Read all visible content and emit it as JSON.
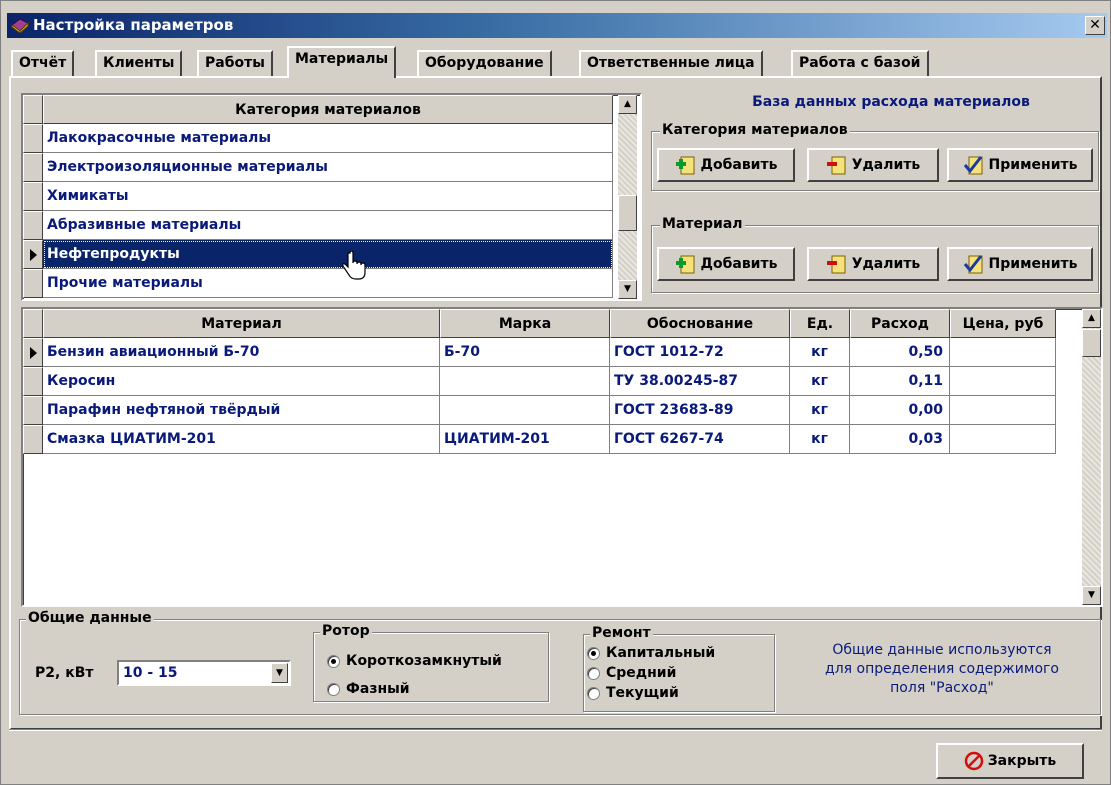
{
  "window": {
    "title": "Настройка параметров",
    "close_glyph": "✕"
  },
  "tabs": [
    {
      "label": "Отчёт"
    },
    {
      "label": "Клиенты"
    },
    {
      "label": "Работы"
    },
    {
      "label": "Материалы",
      "active": true
    },
    {
      "label": "Оборудование"
    },
    {
      "label": "Ответственные лица"
    },
    {
      "label": "Работа с базой"
    }
  ],
  "category_grid": {
    "header": "Категория материалов",
    "rows": [
      "Лакокрасочные материалы",
      "Электроизоляционные материалы",
      "Химикаты",
      "Абразивные материалы",
      "Нефтепродукты",
      "Прочие материалы"
    ],
    "selected_index": 4
  },
  "db_panel": {
    "title": "База данных расхода материалов",
    "category_group": {
      "label": "Категория материалов",
      "add": "Добавить",
      "delete": "Удалить",
      "apply": "Применить"
    },
    "material_group": {
      "label": "Материал",
      "add": "Добавить",
      "delete": "Удалить",
      "apply": "Применить"
    }
  },
  "materials_grid": {
    "headers": {
      "material": "Материал",
      "brand": "Марка",
      "basis": "Обоснование",
      "unit": "Ед.",
      "consumption": "Расход",
      "price": "Цена, руб"
    },
    "rows": [
      {
        "material": "Бензин авиационный Б-70",
        "brand": "Б-70",
        "basis": "ГОСТ 1012-72",
        "unit": "кг",
        "consumption": "0,50",
        "price": ""
      },
      {
        "material": "Керосин",
        "brand": "",
        "basis": "ТУ 38.00245-87",
        "unit": "кг",
        "consumption": "0,11",
        "price": ""
      },
      {
        "material": "Парафин нефтяной твёрдый",
        "brand": "",
        "basis": "ГОСТ 23683-89",
        "unit": "кг",
        "consumption": "0,00",
        "price": ""
      },
      {
        "material": "Смазка ЦИАТИМ-201",
        "brand": "ЦИАТИМ-201",
        "basis": "ГОСТ 6267-74",
        "unit": "кг",
        "consumption": "0,03",
        "price": ""
      }
    ]
  },
  "general": {
    "label": "Общие данные",
    "power_label": "P2, кВт",
    "power_value": "10 - 15",
    "rotor": {
      "label": "Ротор",
      "options": [
        {
          "label": "Короткозамкнутый",
          "checked": true
        },
        {
          "label": "Фазный",
          "checked": false
        }
      ]
    },
    "repair": {
      "label": "Ремонт",
      "options": [
        {
          "label": "Капитальный",
          "checked": true
        },
        {
          "label": "Средний",
          "checked": false
        },
        {
          "label": "Текущий",
          "checked": false
        }
      ]
    },
    "info": [
      "Общие данные используются",
      "для определения содержимого",
      "поля \"Расход\""
    ]
  },
  "footer": {
    "close_label": "Закрыть"
  },
  "colors": {
    "selection": "#0a246a",
    "data_text": "#0a1a7a",
    "face": "#d4d0c8"
  }
}
